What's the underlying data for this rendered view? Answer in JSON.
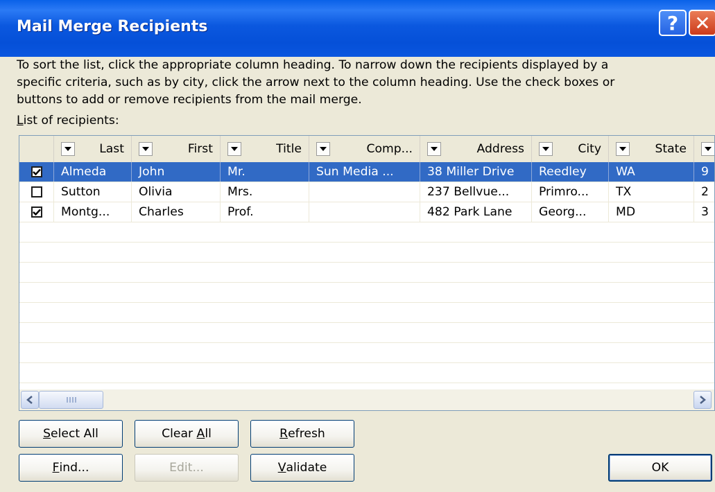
{
  "window": {
    "title": "Mail Merge Recipients",
    "help_label": "?",
    "close_label": "✕"
  },
  "instructions": "To sort the list, click the appropriate column heading.  To narrow down the recipients displayed by a\nspecific criteria, such as by city, click the arrow next to the column heading.  Use the check boxes or\nbuttons to add or remove recipients from the mail merge.",
  "list_label": {
    "accel": "L",
    "rest": "ist of recipients:"
  },
  "columns": [
    "Last",
    "First",
    "Title",
    "Comp...",
    "Address",
    "City",
    "State"
  ],
  "rows": [
    {
      "checked": true,
      "selected": true,
      "cells": [
        "Almeda",
        "John",
        "Mr.",
        "Sun Media ...",
        "38 Miller Drive",
        "Reedley",
        "WA",
        "9"
      ]
    },
    {
      "checked": false,
      "selected": false,
      "cells": [
        "Sutton",
        "Olivia",
        "Mrs.",
        "",
        "237 Bellvue...",
        "Primro...",
        "TX",
        "2"
      ]
    },
    {
      "checked": true,
      "selected": false,
      "cells": [
        "Montg...",
        "Charles",
        "Prof.",
        "",
        "482 Park Lane",
        "Georg...",
        "MD",
        "3"
      ]
    }
  ],
  "buttons": {
    "select_all": {
      "accel": "S",
      "rest": "elect All"
    },
    "clear_all": {
      "pre": "Clear ",
      "accel": "A",
      "rest": "ll"
    },
    "refresh": {
      "accel": "R",
      "rest": "efresh"
    },
    "find": {
      "accel": "F",
      "rest": "ind..."
    },
    "edit": "Edit...",
    "validate": {
      "accel": "V",
      "rest": "alidate"
    },
    "ok": "OK"
  },
  "colors": {
    "titlebar": "#0550d8",
    "selection": "#316ac5",
    "dialog_bg": "#ece9d8"
  },
  "icons": [
    "help-icon",
    "close-icon",
    "dropdown-arrow-icon",
    "checkmark-icon",
    "scroll-left-icon",
    "scroll-right-icon"
  ]
}
